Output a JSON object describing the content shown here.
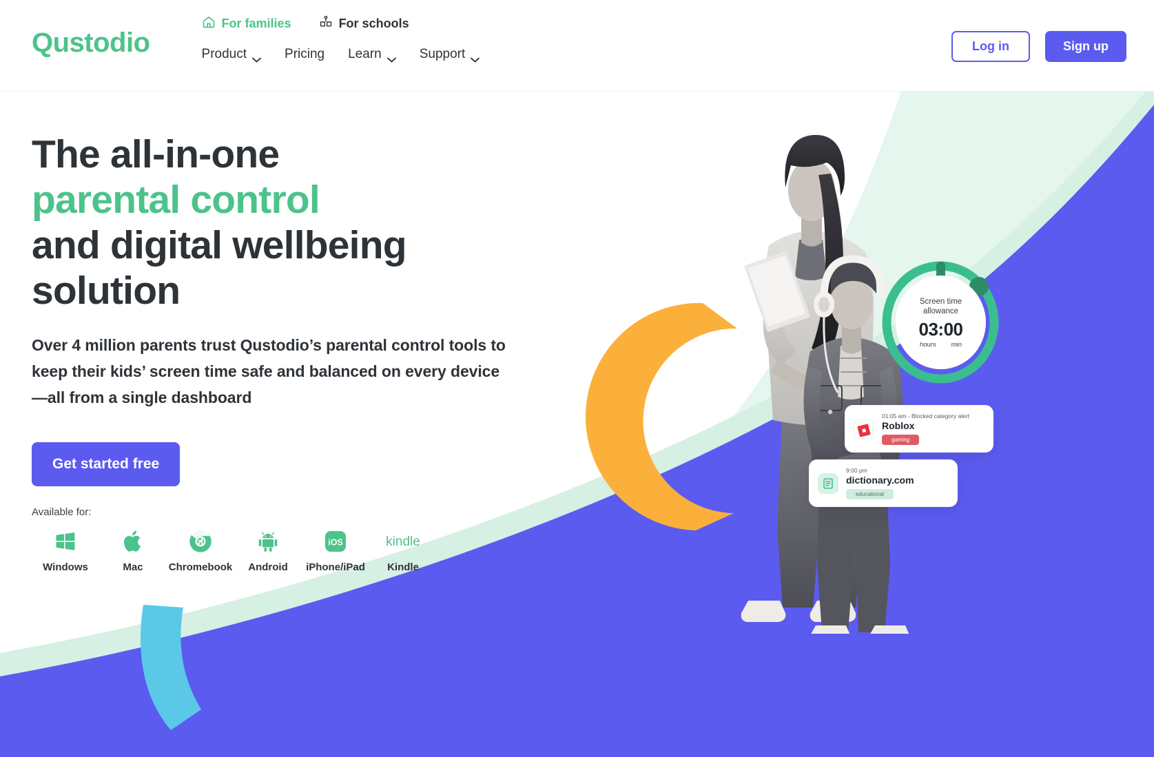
{
  "brand": {
    "logo_text": "Qustodio",
    "green": "#4CC38A",
    "purple": "#5B5BF0",
    "dark": "#2e3338",
    "mint": "#D6F0E4",
    "cyan": "#5BC8E8",
    "orange": "#FBB03B"
  },
  "header": {
    "audience_tabs": [
      {
        "label": "For families",
        "icon": "home-icon",
        "active": true
      },
      {
        "label": "For schools",
        "icon": "school-icon",
        "active": false
      }
    ],
    "nav": [
      {
        "label": "Product",
        "has_dropdown": true
      },
      {
        "label": "Pricing",
        "has_dropdown": false
      },
      {
        "label": "Learn",
        "has_dropdown": true
      },
      {
        "label": "Support",
        "has_dropdown": true
      }
    ],
    "login_label": "Log in",
    "signup_label": "Sign up"
  },
  "hero": {
    "title_line1": "The all-in-one",
    "title_highlight": "parental control",
    "title_line3": "and digital wellbeing",
    "title_line4": "solution",
    "subtitle": "Over 4 million parents trust Qustodio’s parental control tools to keep their kids’ screen time safe and balanced on every device—all from a single dashboard",
    "cta_label": "Get started free",
    "available_label": "Available for:",
    "platforms": [
      {
        "name": "Windows",
        "icon": "windows-icon"
      },
      {
        "name": "Mac",
        "icon": "apple-icon"
      },
      {
        "name": "Chromebook",
        "icon": "chrome-icon"
      },
      {
        "name": "Android",
        "icon": "android-icon"
      },
      {
        "name": "iPhone/iPad",
        "icon": "ios-icon"
      },
      {
        "name": "Kindle",
        "icon": "kindle-icon"
      }
    ]
  },
  "widget": {
    "label_line1": "Screen time",
    "label_line2": "allowance",
    "time": "03:00",
    "unit_hours": "hours",
    "unit_min": "min"
  },
  "cards": [
    {
      "id": "roblox",
      "time": "01:05 am - Blocked category alert",
      "title": "Roblox",
      "badge": "gaming",
      "icon": "roblox-icon"
    },
    {
      "id": "dictionary",
      "time": "9:00 pm",
      "title": "dictionary.com",
      "badge": "educational",
      "icon": "book-icon"
    }
  ]
}
